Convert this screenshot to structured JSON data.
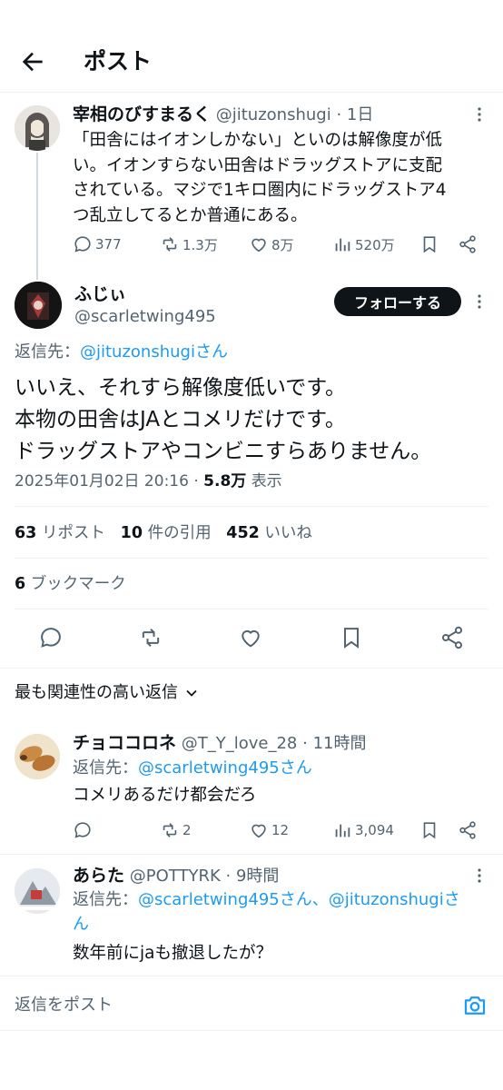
{
  "header": {
    "title": "ポスト"
  },
  "parent": {
    "display_name": "宰相のびすまるく",
    "handle": "@jituzonshugi",
    "time": "1日",
    "text_lines": [
      "「田舎にはイオンしかない」といのは解像度が低",
      "い。イオンすらない田舎はドラッグストアに支配",
      "されている。マジで1キロ圏内にドラッグストア4",
      "つ乱立してるとか普通にある。"
    ],
    "stats": {
      "replies": "377",
      "reposts": "1.3万",
      "likes": "8万",
      "views": "520万"
    }
  },
  "main": {
    "display_name": "ふじぃ",
    "handle": "@scarletwing495",
    "follow_label": "フォローする",
    "reply_to_label": "返信先：",
    "reply_to_handle": "@jituzonshugiさん",
    "text_lines": [
      "いいえ、それすら解像度低いです。",
      "本物の田舎はJAとコメリだけです。",
      "ドラッグストアやコンビニすらありません。"
    ],
    "datetime": "2025年01月02日 20:16",
    "views_num": "5.8万",
    "views_label": "表示",
    "reposts_num": "63",
    "reposts_label": "リポスト",
    "quotes_num": "10",
    "quotes_label": "件の引用",
    "likes_num": "452",
    "likes_label": "いいね",
    "bookmarks_num": "6",
    "bookmarks_label": "ブックマーク"
  },
  "sort_label": "最も関連性の高い返信",
  "replies": [
    {
      "display_name": "チョココロネ",
      "handle": "@T_Y_love_28",
      "time": "11時間",
      "reply_to_label": "返信先：",
      "reply_to": "@scarletwing495さん",
      "text": "コメリあるだけ都会だろ",
      "stats": {
        "replies": "",
        "reposts": "2",
        "likes": "12",
        "views": "3,094"
      }
    },
    {
      "display_name": "あらた",
      "handle": "@POTTYRK",
      "time": "9時間",
      "reply_to_label": "返信先：",
      "reply_to_line1": "@scarletwing495さん、@jituzonshugiさ",
      "reply_to_line2": "ん",
      "text": "数年前にjaも撤退したが？"
    }
  ],
  "composer": {
    "placeholder": "返信をポスト"
  }
}
